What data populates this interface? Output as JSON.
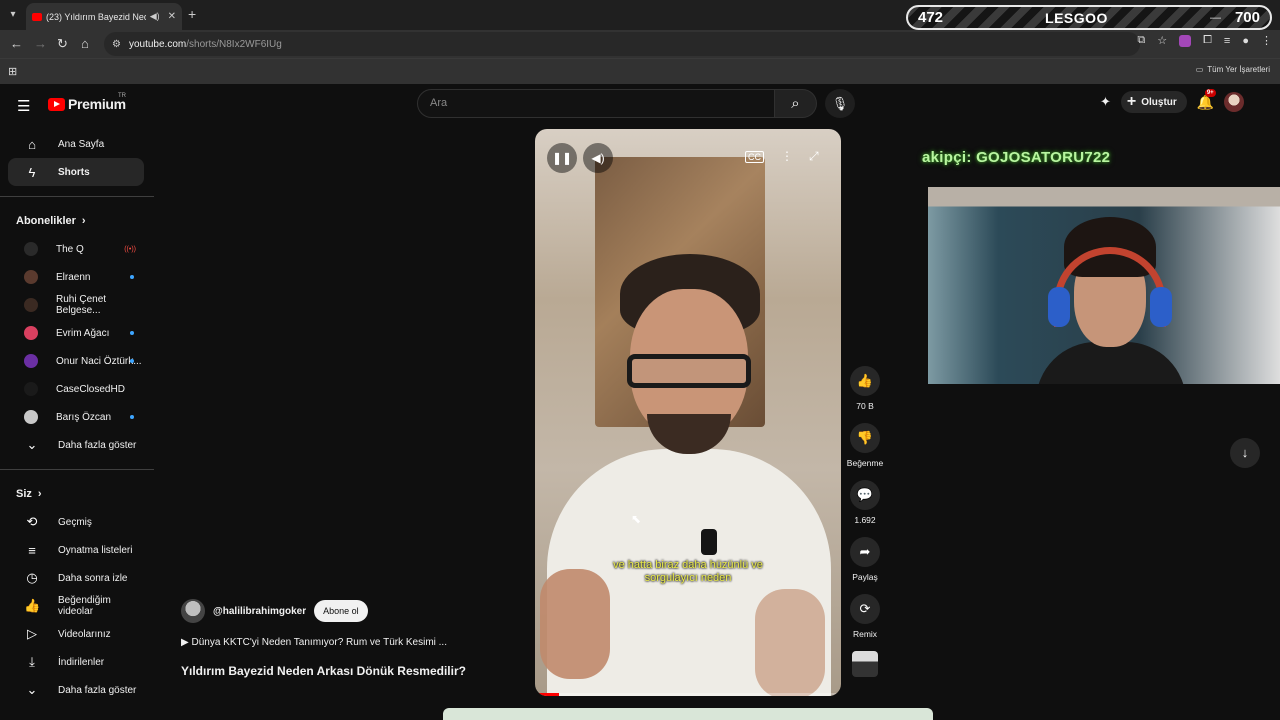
{
  "browser": {
    "tab_title": "(23) Yıldırım Bayezid Neden",
    "url_host": "youtube.com",
    "url_path": "/shorts/N8Ix2WF6IUg",
    "bookmarks_label": "Tüm Yer İşaretleri"
  },
  "stream_overlay": {
    "left_value": "472",
    "center_text": "LESGOO",
    "right_value": "700",
    "chat_text": "akipçi: GOJOSATORU722"
  },
  "youtube": {
    "logo_text": "Premium",
    "region": "TR",
    "search_placeholder": "Ara",
    "create_label": "Oluştur",
    "notification_count": "9+"
  },
  "sidebar": {
    "main": [
      {
        "label": "Ana Sayfa",
        "icon": "home-icon"
      },
      {
        "label": "Shorts",
        "icon": "shorts-icon",
        "active": true
      }
    ],
    "subscriptions_header": "Abonelikler",
    "subscriptions": [
      {
        "label": "The Q",
        "status": "live",
        "color": "#2a2a2a"
      },
      {
        "label": "Elraenn",
        "status": "new",
        "color": "#5a3a2e"
      },
      {
        "label": "Ruhi Çenet Belgese...",
        "status": "none",
        "color": "#3b2a22"
      },
      {
        "label": "Evrim Ağacı",
        "status": "new",
        "color": "#d94060"
      },
      {
        "label": "Onur Naci Öztürk...",
        "status": "new",
        "color": "#6b2fa3"
      },
      {
        "label": "CaseClosedHD",
        "status": "none",
        "color": "#1a1a1a"
      },
      {
        "label": "Barış Özcan",
        "status": "new",
        "color": "#c9c9c9"
      }
    ],
    "show_more_1": "Daha fazla göster",
    "you_header": "Siz",
    "you_items": [
      {
        "label": "Geçmiş",
        "icon": "history-icon"
      },
      {
        "label": "Oynatma listeleri",
        "icon": "playlists-icon"
      },
      {
        "label": "Daha sonra izle",
        "icon": "watch-later-icon"
      },
      {
        "label": "Beğendiğim videolar",
        "icon": "liked-videos-icon"
      },
      {
        "label": "Videolarınız",
        "icon": "your-videos-icon"
      },
      {
        "label": "İndirilenler",
        "icon": "downloads-icon"
      }
    ],
    "show_more_2": "Daha fazla göster"
  },
  "video": {
    "subtitle_line1": "ve hatta biraz daha hüzünlü ve",
    "subtitle_line2": "sorgulayıcı neden",
    "channel": "@halilibrahimgoker",
    "subscribe_label": "Abone ol",
    "playlist": "Dünya KKTC'yi Neden Tanımıyor? Rum ve Türk Kesimi ...",
    "title": "Yıldırım Bayezid Neden Arkası Dönük Resmedilir?",
    "progress_fraction": 0.08
  },
  "actions": {
    "like_count": "70 B",
    "dislike_label": "Beğenme",
    "comment_count": "1.692",
    "share_label": "Paylaş",
    "remix_label": "Remix"
  }
}
